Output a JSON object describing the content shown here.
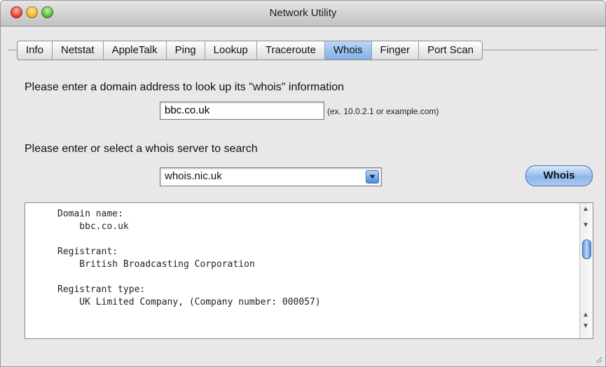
{
  "window": {
    "title": "Network Utility"
  },
  "tabs": [
    {
      "label": "Info"
    },
    {
      "label": "Netstat"
    },
    {
      "label": "AppleTalk"
    },
    {
      "label": "Ping"
    },
    {
      "label": "Lookup"
    },
    {
      "label": "Traceroute"
    },
    {
      "label": "Whois"
    },
    {
      "label": "Finger"
    },
    {
      "label": "Port Scan"
    }
  ],
  "active_tab": "Whois",
  "whois": {
    "domain_prompt": "Please enter a domain address to look up its \"whois\" information",
    "domain_value": "bbc.co.uk",
    "domain_hint": "(ex. 10.0.2.1 or example.com)",
    "server_prompt": "Please enter or select a whois server to search",
    "server_value": "whois.nic.uk",
    "button_label": "Whois",
    "output": "Domain name:\n    bbc.co.uk\n\nRegistrant:\n    British Broadcasting Corporation\n\nRegistrant type:\n    UK Limited Company, (Company number: 000057)"
  },
  "colors": {
    "accent": "#7fb0e6",
    "window_bg": "#e8e8e8"
  },
  "icons": [
    "close-window-icon",
    "minimize-window-icon",
    "zoom-window-icon",
    "dropdown-arrow-icon",
    "scroll-up-icon",
    "scroll-down-icon",
    "resize-grip-icon"
  ]
}
